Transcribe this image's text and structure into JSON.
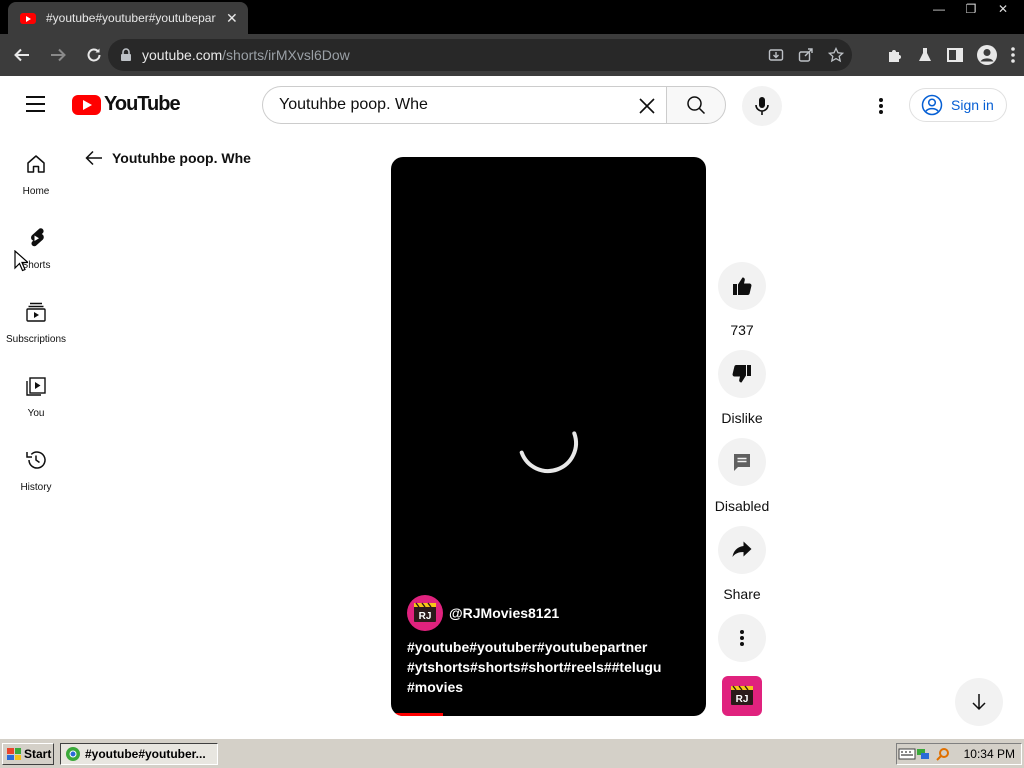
{
  "browser": {
    "tab_title": "#youtube#youtuber#youtubepartner",
    "tab_close": "✕",
    "url_host": "youtube.com",
    "url_path": "/shorts/irMXvsl6Dow",
    "window_buttons": [
      "—",
      "❐",
      "✕"
    ]
  },
  "masthead": {
    "logo_text": "YouTube",
    "search_value": "Youtuhbe poop. Whe",
    "signin_label": "Sign in"
  },
  "guide": {
    "items": [
      {
        "label": "Home",
        "icon": "home-icon"
      },
      {
        "label": "Shorts",
        "icon": "shorts-icon"
      },
      {
        "label": "Subscriptions",
        "icon": "subscriptions-icon"
      },
      {
        "label": "You",
        "icon": "you-icon"
      },
      {
        "label": "History",
        "icon": "history-icon"
      }
    ]
  },
  "page": {
    "back_title": "Youtuhbe poop. Whe"
  },
  "short": {
    "channel_handle": "@RJMovies8121",
    "channel_avatar_text": "RJ",
    "caption": "#youtube#youtuber#youtubepartner #ytshorts#shorts#short#reels##telugu #movies"
  },
  "actions": {
    "like_count": "737",
    "dislike_label": "Dislike",
    "comments_label": "Disabled",
    "share_label": "Share"
  },
  "taskbar": {
    "start_label": "Start",
    "task_label": "#youtube#youtuber...",
    "clock": "10:34 PM"
  },
  "colors": {
    "youtube_red": "#ff0000",
    "link_blue": "#065fd4",
    "channel_pink": "#e0227e"
  }
}
